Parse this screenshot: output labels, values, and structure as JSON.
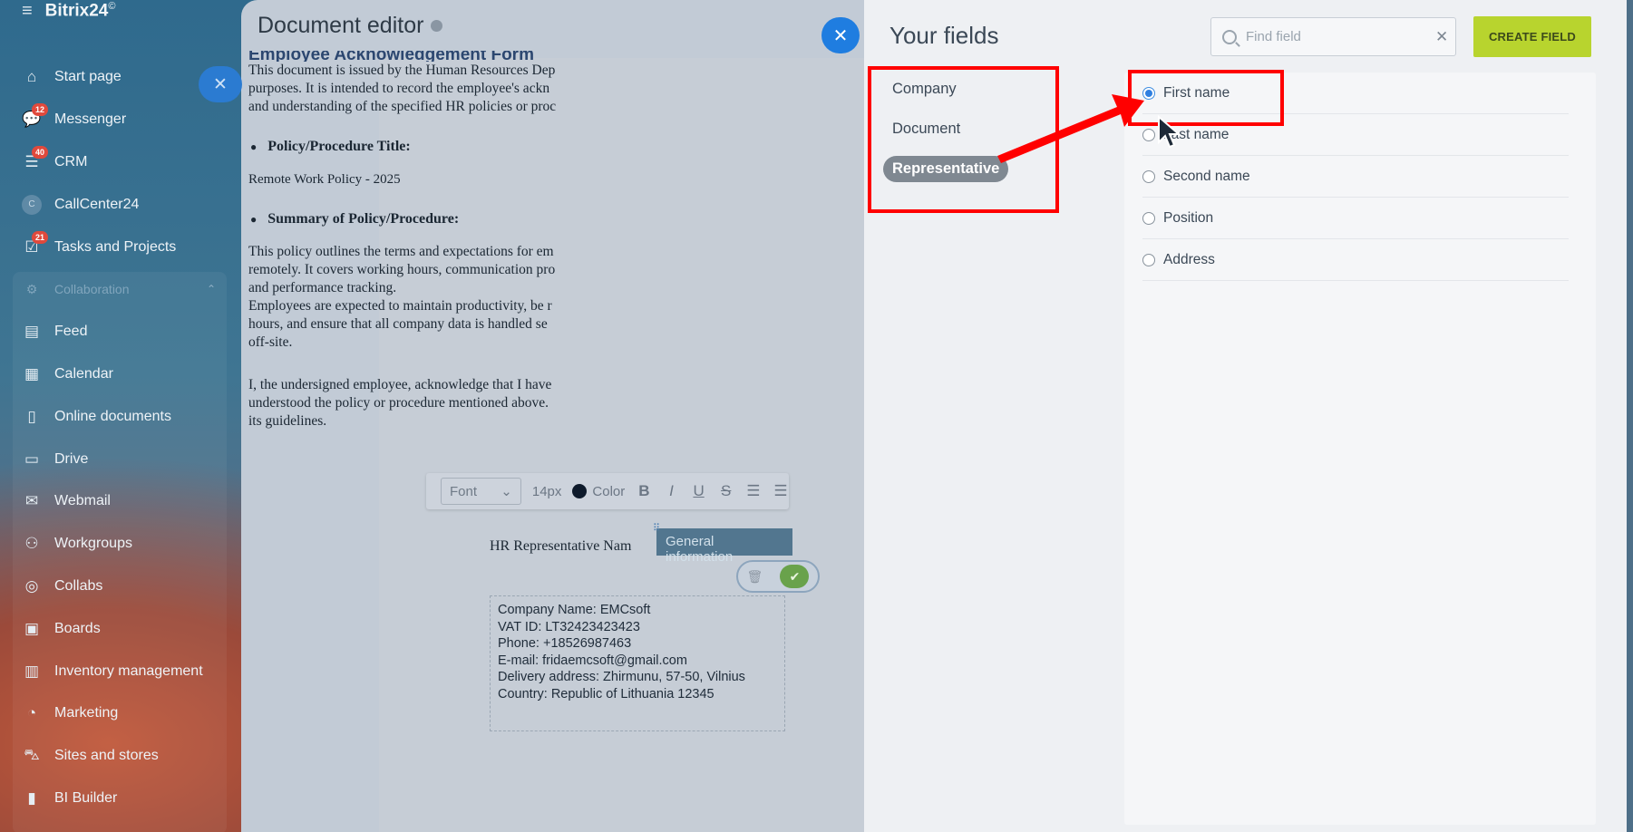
{
  "sidebar": {
    "brand": "Bitrix24",
    "brand_mark": "©",
    "items": [
      {
        "label": "Start page",
        "icon": "home-icon"
      },
      {
        "label": "Messenger",
        "icon": "chat-icon",
        "badge": "12"
      },
      {
        "label": "CRM",
        "icon": "funnel-icon",
        "badge": "40"
      },
      {
        "label": "CallCenter24",
        "icon": "callcenter-icon",
        "icon_text": "C"
      },
      {
        "label": "Tasks and Projects",
        "icon": "checklist-icon",
        "badge": "21"
      },
      {
        "label": "Collaboration",
        "icon": "collaboration-icon",
        "section": true
      },
      {
        "label": "Feed",
        "icon": "feed-icon"
      },
      {
        "label": "Calendar",
        "icon": "calendar-icon"
      },
      {
        "label": "Online documents",
        "icon": "document-icon"
      },
      {
        "label": "Drive",
        "icon": "drive-icon"
      },
      {
        "label": "Webmail",
        "icon": "mail-icon"
      },
      {
        "label": "Workgroups",
        "icon": "group-icon"
      },
      {
        "label": "Collabs",
        "icon": "collabs-icon"
      },
      {
        "label": "Boards",
        "icon": "board-icon"
      },
      {
        "label": "Inventory management",
        "icon": "inventory-icon"
      },
      {
        "label": "Marketing",
        "icon": "marketing-icon"
      },
      {
        "label": "Sites and stores",
        "icon": "cart-icon"
      },
      {
        "label": "BI Builder",
        "icon": "chart-icon"
      }
    ]
  },
  "editor": {
    "title": "Document editor",
    "close_glyph": "✕",
    "side_close_glyph": "✕",
    "document": {
      "heading": "Employee Acknowledgement Form",
      "intro_lines": [
        "This document is issued by the Human Resources Dep",
        "purposes. It is intended to record the employee's ackn",
        "and understanding of the specified HR policies or proc"
      ],
      "policy_title_label": "Policy/Procedure Title:",
      "policy_title_value": "Remote Work Policy - 2025",
      "summary_label": "Summary of Policy/Procedure:",
      "summary_lines": [
        "This policy outlines the terms and expectations for em",
        "remotely. It covers working hours, communication pro",
        "and performance tracking.",
        "Employees are expected to maintain productivity, be r",
        "hours, and ensure that all company data is handled se",
        "off-site."
      ],
      "ack_lines": [
        "I, the undersigned employee, acknowledge that I have",
        "understood the policy or procedure mentioned above.",
        "its guidelines."
      ],
      "hr_rep_label": "HR Representative Nam",
      "company_block": [
        "Company Name: EMCsoft",
        "VAT ID: LT32423423423",
        "Phone: +18526987463",
        "E-mail: fridaemcsoft@gmail.com",
        "Delivery address: Zhirmunu, 57-50, Vilnius",
        "Country: Republic of Lithuania 12345"
      ]
    },
    "toolbar": {
      "font": "Font",
      "size": "14px",
      "color": "Color",
      "color_value": "#0e1a2b",
      "buttons": [
        "B",
        "I",
        "U",
        "S"
      ]
    },
    "block_tag": "General information"
  },
  "fields_panel": {
    "title": "Your fields",
    "search_placeholder": "Find field",
    "create_label": "CREATE FIELD",
    "categories": [
      "Company",
      "Document",
      "Representative"
    ],
    "active_category": "Representative",
    "fields": [
      {
        "label": "First name",
        "selected": true
      },
      {
        "label": "Last name",
        "selected": false
      },
      {
        "label": "Second name",
        "selected": false
      },
      {
        "label": "Position",
        "selected": false
      },
      {
        "label": "Address",
        "selected": false
      }
    ]
  },
  "colors": {
    "accent_blue": "#1f7de0",
    "create_button": "#b8d42e",
    "annotation_red": "#ff0000",
    "badge_red": "#e0493c"
  }
}
